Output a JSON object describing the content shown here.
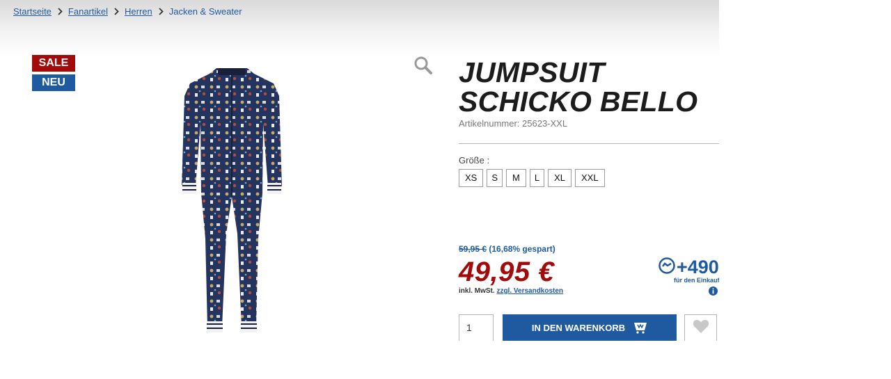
{
  "breadcrumb": {
    "items": [
      "Startseite",
      "Fanartikel",
      "Herren"
    ],
    "current": "Jacken & Sweater"
  },
  "badges": {
    "sale": "SALE",
    "new": "NEU"
  },
  "product": {
    "title_line1": "JUMPSUIT",
    "title_line2": "SCHICKO BELLO",
    "article_number": "Artikelnummer: 25623-XXL"
  },
  "sizes": {
    "label": "Größe :",
    "options": [
      "XS",
      "S",
      "M",
      "L",
      "XL",
      "XXL"
    ]
  },
  "price": {
    "old": "59,95 €",
    "saved": "(16,68% gespart)",
    "current": "49,95 €",
    "tax_note": "inkl. MwSt.",
    "shipping_link": "zzgl. Versandkosten"
  },
  "points": {
    "value": "+490",
    "label": "für den Einkauf"
  },
  "cart": {
    "quantity": "1",
    "add_label": "IN DEN WARENKORB"
  },
  "colors": {
    "accent_blue": "#1f5aa0",
    "sale_red": "#a30b0b"
  },
  "icons": {
    "zoom": "magnifier-icon",
    "cart": "cart-icon",
    "wishlist": "heart-icon",
    "info": "info-icon",
    "points": "points-icon"
  }
}
